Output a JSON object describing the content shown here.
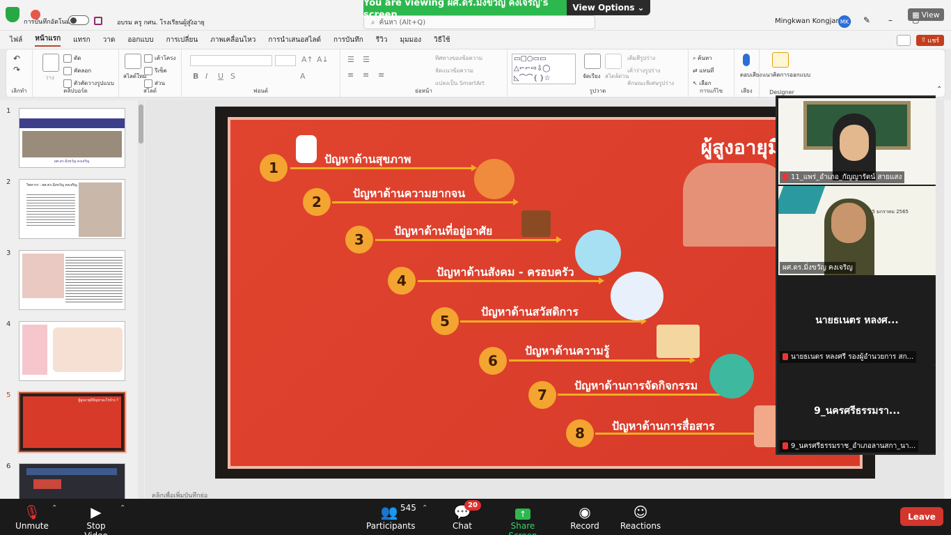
{
  "titlebar": {
    "autosave_label": "การบันทึกอัตโนมัติ",
    "doc_title": "อบรม ครู กศน. โรงเรียนผู้สูงอายุ",
    "search_placeholder": "ค้นหา (Alt+Q)",
    "user_name": "Mingkwan Kongjareon",
    "user_initials": "MK"
  },
  "zoom": {
    "banner_text": "You are viewing ผศ.ดร.มิ่งขวัญ คงเจริญ's screen",
    "view_options": "View Options",
    "view_button": "View"
  },
  "menu": [
    "ไฟล์",
    "หน้าแรก",
    "แทรก",
    "วาด",
    "ออกแบบ",
    "การเปลี่ยน",
    "ภาพเคลื่อนไหว",
    "การนำเสนอสไลด์",
    "การบันทึก",
    "รีวิว",
    "มุมมอง",
    "วิธีใช้"
  ],
  "menu_active": 1,
  "share_label": "แชร์",
  "ribbon": {
    "undo_group": "เลิกทำ",
    "clipboard": {
      "cut": "ตัด",
      "copy": "คัดลอก",
      "format": "ตัวคัดวางรูปแบบ",
      "paste": "วาง",
      "label": "คลิปบอร์ด"
    },
    "slides": {
      "new": "สไลด์ใหม่",
      "layout": "เค้าโครง",
      "reset": "รีเซ็ต",
      "section": "ส่วน",
      "label": "สไลด์"
    },
    "font_label": "ฟอนต์",
    "paragraph": {
      "dir": "ทิศทางของข้อความ",
      "align": "จัดแนวข้อความ",
      "smartart": "แปลงเป็น SmartArt",
      "label": "ย่อหน้า"
    },
    "drawing": {
      "arrange": "จัดเรียง",
      "styles": "สไตล์ด่วน",
      "fill": "เติมสีรูปร่าง",
      "outline": "เค้าร่างรูปร่าง",
      "effects": "ลักษณะพิเศษรูปร่าง",
      "label": "รูปวาด"
    },
    "editing": {
      "find": "ค้นหา",
      "replace": "แทนที่",
      "select": "เลือก",
      "label": "การแก้ไข"
    },
    "voice": {
      "dictate": "ตอบเสียง",
      "label": "เสียง"
    },
    "designer": {
      "ideas": "แนวคิดการออกแบบ",
      "label": "Designer"
    }
  },
  "thumbnails": [
    {
      "n": "1",
      "text": "ผศ.ดร.มิ่งขวัญ คงเจริญ"
    },
    {
      "n": "2",
      "text": "วิทยากร : ผศ.ดร.มิ่งขวัญ คงเจริญ"
    },
    {
      "n": "3",
      "text": ""
    },
    {
      "n": "4",
      "text": ""
    },
    {
      "n": "5",
      "text": "ผู้สูงอายุมีปัญหาอะไรบ้าง ?"
    },
    {
      "n": "6",
      "text": ""
    }
  ],
  "selected_slide": 5,
  "slide": {
    "title": "ผู้สูงอายุมีปัญหาอะไ",
    "items": [
      {
        "n": "1",
        "text": "ปัญหาด้านสุขภาพ"
      },
      {
        "n": "2",
        "text": "ปัญหาด้านความยากจน"
      },
      {
        "n": "3",
        "text": "ปัญหาด้านที่อยู่อาศัย"
      },
      {
        "n": "4",
        "text": "ปัญหาด้านสังคม - ครอบครัว"
      },
      {
        "n": "5",
        "text": "ปัญหาด้านสวัสดิการ"
      },
      {
        "n": "6",
        "text": "ปัญหาด้านความรู้"
      },
      {
        "n": "7",
        "text": "ปัญหาด้านการจัดกิจกรรม"
      },
      {
        "n": "8",
        "text": "ปัญหาด้านการสื่อสาร"
      }
    ]
  },
  "notes_placeholder": "คลิกเพื่อเพิ่มบันทึกย่อ",
  "participants_video": [
    {
      "name": "11_แพร่_อำเภอ_กัญญารัตน์  สายแสง",
      "big": "",
      "muted": true
    },
    {
      "name": "ผศ.ดร.มิ่งขวัญ คงเจริญ",
      "big": "",
      "muted": false,
      "slide_date": "25 มกราคม 2565"
    },
    {
      "name": "นายธเนตร หลงศรี รองผู้อำนวยการ สก...",
      "big": "นายธเนตร หลงศ...",
      "muted": true
    },
    {
      "name": "9_นครศรีธรรมราช_อำเภอลานสกา_นา...",
      "big": "9_นครศรีธรรมรา...",
      "muted": true
    }
  ],
  "controls": {
    "unmute": "Unmute",
    "stop_video": "Stop Video",
    "participants": "Participants",
    "participants_count": "545",
    "chat": "Chat",
    "chat_badge": "20",
    "share": "Share Screen",
    "record": "Record",
    "reactions": "Reactions",
    "leave": "Leave"
  },
  "colors": {
    "accent": "#b7472a",
    "zoom_green": "#2db84d",
    "leave_red": "#d3362d",
    "slide_bg": "#e0442e",
    "number_circle": "#f4a430"
  }
}
